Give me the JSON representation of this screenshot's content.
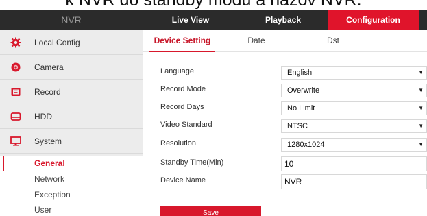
{
  "caption": "k NVR do standby módu a názov NVR.",
  "header": {
    "brand": "NVR",
    "tabs": [
      "Live View",
      "Playback",
      "Configuration"
    ]
  },
  "colors": {
    "accent": "#d8182c",
    "topbar": "#2b2b2b",
    "sidebar": "#ececec"
  },
  "sidebar": {
    "items": [
      {
        "label": "Local Config",
        "icon": "gear-icon"
      },
      {
        "label": "Camera",
        "icon": "camera-icon"
      },
      {
        "label": "Record",
        "icon": "record-icon"
      },
      {
        "label": "HDD",
        "icon": "hdd-icon"
      },
      {
        "label": "System",
        "icon": "monitor-icon"
      }
    ],
    "sub_items": [
      "General",
      "Network",
      "Exception",
      "User"
    ],
    "active_sub": "General"
  },
  "content_tabs": [
    "Device Setting",
    "Date",
    "Dst"
  ],
  "form": {
    "language": {
      "label": "Language",
      "value": "English"
    },
    "record_mode": {
      "label": "Record Mode",
      "value": "Overwrite"
    },
    "record_days": {
      "label": "Record Days",
      "value": "No Limit"
    },
    "video_standard": {
      "label": "Video Standard",
      "value": "NTSC"
    },
    "resolution": {
      "label": "Resolution",
      "value": "1280x1024"
    },
    "standby_time": {
      "label": "Standby Time(Min)",
      "value": "10"
    },
    "device_name": {
      "label": "Device Name",
      "value": "NVR"
    },
    "arrow": "▼"
  },
  "save_label": "Save"
}
